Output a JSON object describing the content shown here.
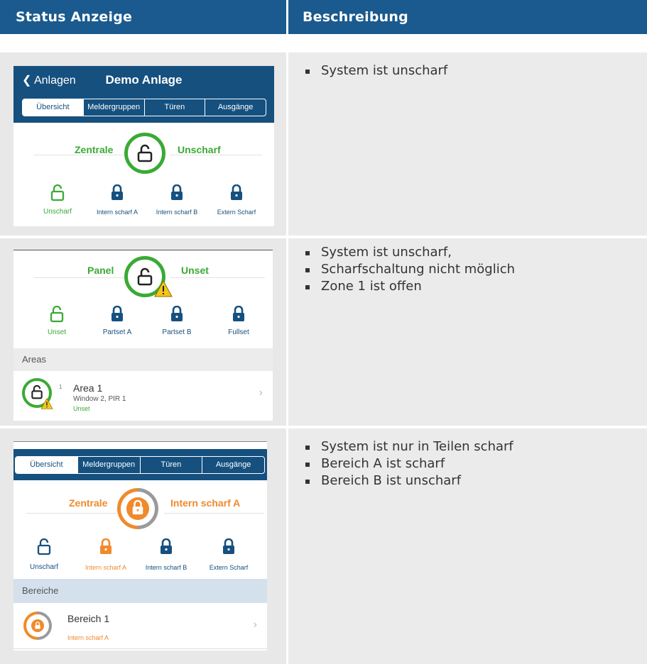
{
  "header": {
    "col1": "Status Anzeige",
    "col2": "Beschreibung"
  },
  "rows": [
    {
      "screen": {
        "back_label": "Anlagen",
        "title": "Demo Anlage",
        "tabs": [
          "Übersicht",
          "Meldergruppen",
          "Türen",
          "Ausgänge"
        ],
        "left_label": "Zentrale",
        "right_label": "Unscharf",
        "modes": [
          "Unscharf",
          "Intern scharf A",
          "Intern scharf B",
          "Extern Scharf"
        ]
      },
      "bullets": [
        "System ist unscharf"
      ]
    },
    {
      "screen": {
        "left_label": "Panel",
        "right_label": "Unset",
        "modes": [
          "Unset",
          "Partset A",
          "Partset B",
          "Fullset"
        ],
        "section": "Areas",
        "item_title": "Area 1",
        "item_sub": "Window 2, PIR 1",
        "item_status": "Unset",
        "item_badge": "1"
      },
      "bullets": [
        "System ist unscharf,",
        "Scharfschaltung nicht möglich",
        "Zone 1 ist offen"
      ]
    },
    {
      "screen": {
        "tabs": [
          "Übersicht",
          "Meldergruppen",
          "Türen",
          "Ausgänge"
        ],
        "left_label": "Zentrale",
        "right_label": "Intern scharf A",
        "modes": [
          "Unscharf",
          "Intern scharf A",
          "Intern scharf B",
          "Extern Scharf"
        ],
        "section": "Bereiche",
        "item_title": "Bereich 1",
        "item_status": "Intern scharf A"
      },
      "bullets": [
        "System ist nur in Teilen scharf",
        "Bereich A ist scharf",
        "Bereich B ist unscharf"
      ]
    }
  ],
  "colors": {
    "header_bg": "#1a5a8e",
    "green": "#3aaa35",
    "orange": "#f08a2c",
    "blue": "#15507f",
    "warning": "#f5c518"
  },
  "icons": [
    "chevron-left-icon",
    "lock-open-icon",
    "lock-closed-icon",
    "warning-icon",
    "chevron-right-icon"
  ]
}
